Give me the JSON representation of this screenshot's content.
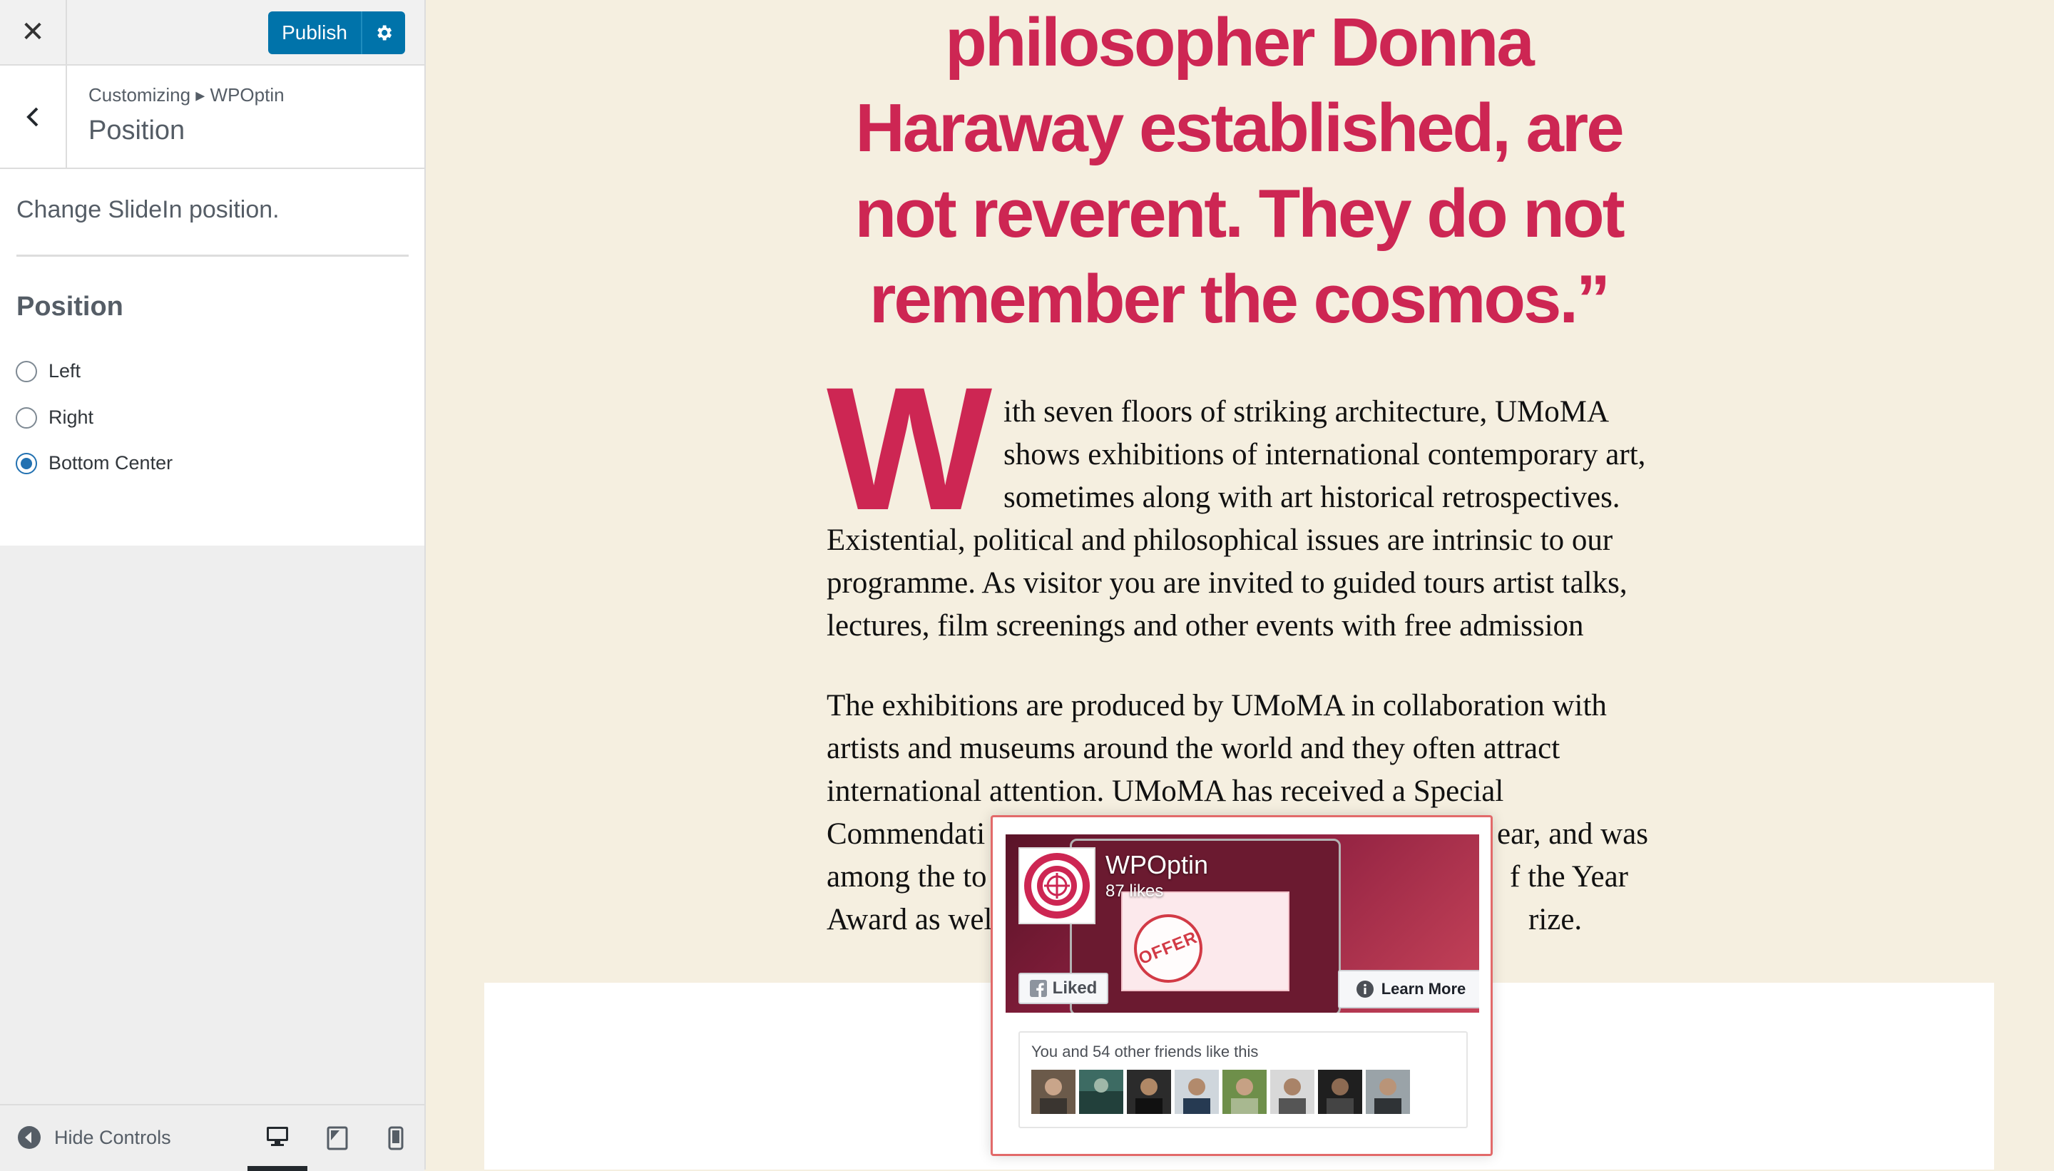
{
  "topbar": {
    "close_icon": "close-icon",
    "publish_label": "Publish",
    "settings_icon": "gear-icon"
  },
  "section": {
    "breadcrumb": "Customizing ▸ WPOptin",
    "title": "Position"
  },
  "panel": {
    "description": "Change SlideIn position.",
    "control_title": "Position",
    "options": [
      {
        "label": "Left",
        "checked": false
      },
      {
        "label": "Right",
        "checked": false
      },
      {
        "label": "Bottom Center",
        "checked": true
      }
    ]
  },
  "footer": {
    "hide_controls_label": "Hide Controls",
    "devices": [
      "desktop",
      "tablet",
      "mobile"
    ],
    "active_device": "desktop"
  },
  "preview": {
    "quote_lines": [
      "philosopher Donna",
      "Haraway established, are",
      "not reverent. They do not",
      "remember the cosmos.”"
    ],
    "dropcap": "W",
    "paragraph1_lines": [
      "ith seven floors of striking architecture, UMoMA",
      "shows exhibitions of international contemporary art,",
      "sometimes along with art historical retrospectives.",
      "Existential, political and philosophical issues are intrinsic to our",
      "programme. As visitor you are invited to guided tours artist talks,",
      "lectures, film screenings and other events with free admission"
    ],
    "paragraph2_left": [
      "The exhibitions are produced by UMoMA in collaboration with",
      "artists and museums around the world and they often attract",
      "international attention. UMoMA has received a Special",
      "Commendati",
      "among the to",
      "Award as well"
    ],
    "paragraph2_right": [
      "ear, and was",
      "f the Year",
      "rize."
    ]
  },
  "slidein": {
    "page_name": "WPOptin",
    "likes": "87 likes",
    "liked_label": "Liked",
    "learn_more_label": "Learn More",
    "friends_text": "You and 54 other friends like this",
    "offer_text": "OFFER",
    "brand_color": "#cd2653",
    "friend_count": 8
  }
}
